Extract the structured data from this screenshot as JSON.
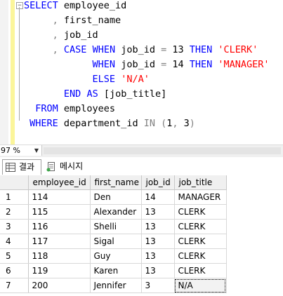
{
  "editor": {
    "lines": [
      [
        {
          "t": "SELECT",
          "c": "kw"
        },
        {
          "t": " employee_id"
        }
      ],
      [
        {
          "t": "     , ",
          "c": "op"
        },
        {
          "t": "first_name"
        }
      ],
      [
        {
          "t": "     , ",
          "c": "op"
        },
        {
          "t": "job_id"
        }
      ],
      [
        {
          "t": "     , ",
          "c": "op"
        },
        {
          "t": "CASE",
          "c": "kw"
        },
        {
          "t": " "
        },
        {
          "t": "WHEN",
          "c": "kw"
        },
        {
          "t": " job_id "
        },
        {
          "t": "=",
          "c": "op"
        },
        {
          "t": " 13 "
        },
        {
          "t": "THEN",
          "c": "kw"
        },
        {
          "t": " "
        },
        {
          "t": "'CLERK'",
          "c": "str"
        }
      ],
      [
        {
          "t": "            "
        },
        {
          "t": "WHEN",
          "c": "kw"
        },
        {
          "t": " job_id "
        },
        {
          "t": "=",
          "c": "op"
        },
        {
          "t": " 14 "
        },
        {
          "t": "THEN",
          "c": "kw"
        },
        {
          "t": " "
        },
        {
          "t": "'MANAGER'",
          "c": "str"
        }
      ],
      [
        {
          "t": "            "
        },
        {
          "t": "ELSE",
          "c": "kw"
        },
        {
          "t": " "
        },
        {
          "t": "'N/A'",
          "c": "str"
        }
      ],
      [
        {
          "t": "       "
        },
        {
          "t": "END",
          "c": "kw"
        },
        {
          "t": " "
        },
        {
          "t": "AS",
          "c": "kw"
        },
        {
          "t": " [job_title]"
        }
      ],
      [
        {
          "t": "  "
        },
        {
          "t": "FROM",
          "c": "kw"
        },
        {
          "t": " employees"
        }
      ],
      [
        {
          "t": " "
        },
        {
          "t": "WHERE",
          "c": "kw"
        },
        {
          "t": " department_id "
        },
        {
          "t": "IN",
          "c": "op"
        },
        {
          "t": " "
        },
        {
          "t": "(",
          "c": "op"
        },
        {
          "t": "1"
        },
        {
          "t": ",",
          "c": "op"
        },
        {
          "t": " 3"
        },
        {
          "t": ")",
          "c": "op"
        }
      ]
    ]
  },
  "zoom": {
    "value": "97 %"
  },
  "tabs": {
    "results": "결과",
    "messages": "메시지"
  },
  "grid": {
    "columns": [
      "employee_id",
      "first_name",
      "job_id",
      "job_title"
    ],
    "rows": [
      [
        "1",
        "114",
        "Den",
        "14",
        "MANAGER"
      ],
      [
        "2",
        "115",
        "Alexander",
        "13",
        "CLERK"
      ],
      [
        "3",
        "116",
        "Shelli",
        "13",
        "CLERK"
      ],
      [
        "4",
        "117",
        "Sigal",
        "13",
        "CLERK"
      ],
      [
        "5",
        "118",
        "Guy",
        "13",
        "CLERK"
      ],
      [
        "6",
        "119",
        "Karen",
        "13",
        "CLERK"
      ],
      [
        "7",
        "200",
        "Jennifer",
        "3",
        "N/A"
      ]
    ]
  },
  "colors": {
    "keyword": "#0000ff",
    "string": "#ff0000",
    "operator": "#808080"
  }
}
